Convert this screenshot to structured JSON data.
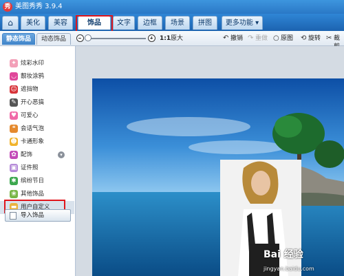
{
  "app": {
    "title": "美图秀秀 3.9.4",
    "logo_glyph": "秀"
  },
  "tabs": [
    {
      "label": "⌂",
      "icon": "home-icon"
    },
    {
      "label": "美化"
    },
    {
      "label": "美容"
    },
    {
      "label": "饰品",
      "active": true
    },
    {
      "label": "文字"
    },
    {
      "label": "边框"
    },
    {
      "label": "场景"
    },
    {
      "label": "拼图"
    },
    {
      "label": "更多功能 ▾"
    }
  ],
  "subtabs": {
    "static": "静态饰品",
    "dynamic": "动态饰品"
  },
  "toolbar": {
    "ratio": "1:1",
    "original_size": "原大",
    "undo": "撤销",
    "redo": "重做",
    "original_image": "原图",
    "rotate": "旋转",
    "crop": "裁剪"
  },
  "sidebar": {
    "items": [
      {
        "label": "炫彩水印",
        "icon": "watermark-icon",
        "color": "#f3a0b8"
      },
      {
        "label": "靓妆涂鸦",
        "icon": "lips-icon",
        "color": "#e0479a"
      },
      {
        "label": "遮挡物",
        "icon": "mask-icon",
        "color": "#d8343a"
      },
      {
        "label": "开心恶搞",
        "icon": "prank-icon",
        "color": "#555555"
      },
      {
        "label": "可爱心",
        "icon": "heart-icon",
        "color": "#f06aa8"
      },
      {
        "label": "会话气泡",
        "icon": "speech-bubble-icon",
        "color": "#e58a2e"
      },
      {
        "label": "卡通形象",
        "icon": "cartoon-icon",
        "color": "#f1b32b"
      },
      {
        "label": "配饰",
        "icon": "bow-icon",
        "color": "#c34ab8",
        "badge": "▾"
      },
      {
        "label": "证件照",
        "icon": "id-photo-icon",
        "color": "#b58bd8"
      },
      {
        "label": "缤纷节日",
        "icon": "festival-icon",
        "color": "#3da84f"
      },
      {
        "label": "其他饰品",
        "icon": "other-icon",
        "color": "#7ab648"
      },
      {
        "label": "用户自定义",
        "icon": "folder-icon",
        "color": "#e9b441",
        "selected": true
      }
    ],
    "import_label": "导入饰品"
  },
  "watermark": {
    "logo": "Bai 经验",
    "url": "jingyan.baidu.com"
  },
  "colors": {
    "highlight": "#e0151b",
    "titlebar": "#2a78c6"
  }
}
